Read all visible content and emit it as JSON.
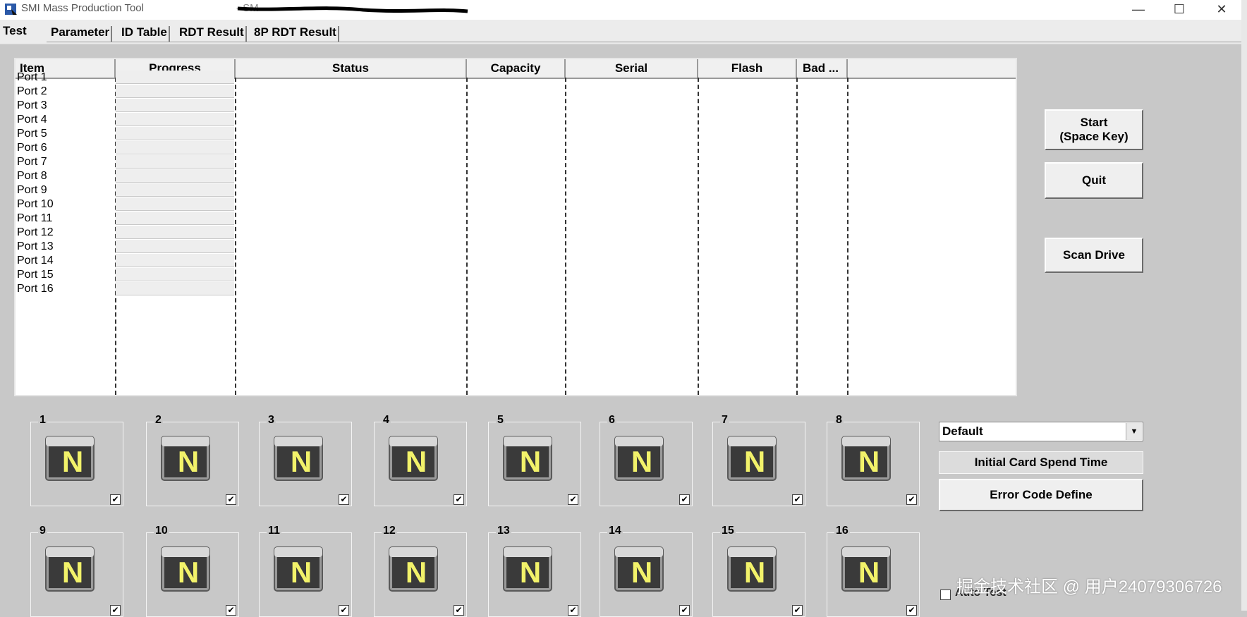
{
  "window": {
    "title": "SMI Mass Production Tool",
    "title_suffix": "- SM",
    "controls": {
      "minimize": "—",
      "maximize": "☐",
      "close": "✕"
    }
  },
  "tabs": [
    "Test",
    "Parameter",
    "ID Table",
    "RDT Result",
    "8P RDT Result"
  ],
  "table": {
    "columns": [
      "Item",
      "Progress",
      "Status",
      "Capacity",
      "Serial",
      "Flash",
      "Bad ..."
    ],
    "rows": [
      "Port 1",
      "Port 2",
      "Port 3",
      "Port 4",
      "Port 5",
      "Port 6",
      "Port 7",
      "Port 8",
      "Port 9",
      "Port 10",
      "Port 11",
      "Port 12",
      "Port 13",
      "Port 14",
      "Port 15",
      "Port 16"
    ]
  },
  "buttons": {
    "start_line1": "Start",
    "start_line2": "(Space Key)",
    "quit": "Quit",
    "scan": "Scan Drive",
    "error_code": "Error Code Define"
  },
  "ports": [
    {
      "number": "1",
      "icon_letter": "N",
      "checked": true
    },
    {
      "number": "2",
      "icon_letter": "N",
      "checked": true
    },
    {
      "number": "3",
      "icon_letter": "N",
      "checked": true
    },
    {
      "number": "4",
      "icon_letter": "N",
      "checked": true
    },
    {
      "number": "5",
      "icon_letter": "N",
      "checked": true
    },
    {
      "number": "6",
      "icon_letter": "N",
      "checked": true
    },
    {
      "number": "7",
      "icon_letter": "N",
      "checked": true
    },
    {
      "number": "8",
      "icon_letter": "N",
      "checked": true
    },
    {
      "number": "9",
      "icon_letter": "N",
      "checked": true
    },
    {
      "number": "10",
      "icon_letter": "N",
      "checked": true
    },
    {
      "number": "11",
      "icon_letter": "N",
      "checked": true
    },
    {
      "number": "12",
      "icon_letter": "N",
      "checked": true
    },
    {
      "number": "13",
      "icon_letter": "N",
      "checked": true
    },
    {
      "number": "14",
      "icon_letter": "N",
      "checked": true
    },
    {
      "number": "15",
      "icon_letter": "N",
      "checked": true
    },
    {
      "number": "16",
      "icon_letter": "N",
      "checked": true
    }
  ],
  "preset": {
    "value": "Default"
  },
  "initial_card_time_label": "Initial Card Spend Time",
  "auto_test": {
    "label": "Auto Test",
    "checked": false
  },
  "watermark": "掘金技术社区 @ 用户24079306726",
  "colors": {
    "background": "#c8c8c8",
    "icon_letter": "#f2f26a",
    "icon_screen": "#3a3a3a"
  }
}
